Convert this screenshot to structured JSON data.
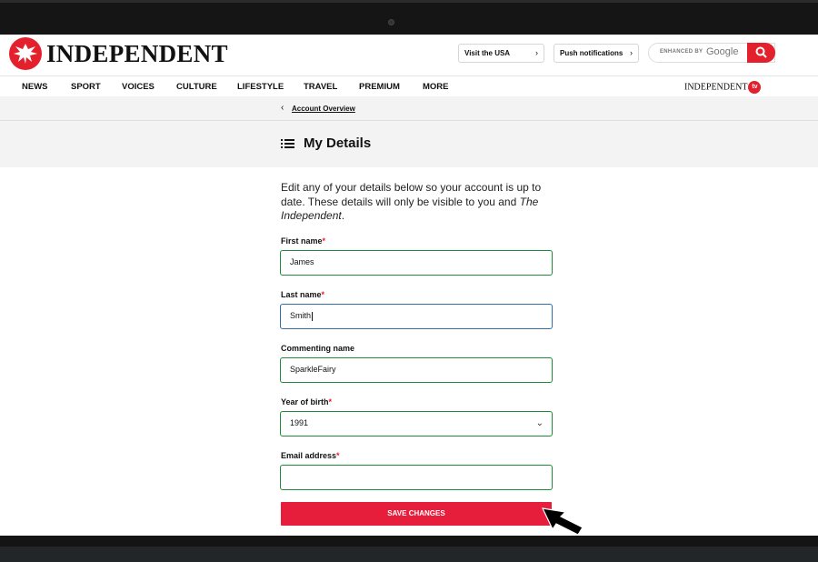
{
  "header": {
    "logo_text": "INDEPENDENT",
    "pills": [
      {
        "label": "Visit the USA"
      },
      {
        "label": "Push notifications"
      }
    ],
    "search": {
      "enhanced_label": "ENHANCED BY",
      "provider": "Google"
    }
  },
  "nav": {
    "items": [
      "NEWS",
      "SPORT",
      "VOICES",
      "CULTURE",
      "LIFESTYLE",
      "TRAVEL",
      "PREMIUM",
      "MORE"
    ],
    "tv_label": "INDEPENDENT",
    "tv_badge": "tv"
  },
  "breadcrumb": "Account Overview",
  "page_title": "My Details",
  "intro": {
    "text": "Edit any of your details below so your account is up to date. These details will only be visible to you and ",
    "publication": "The Independent",
    "end": "."
  },
  "form": {
    "required_mark": "*",
    "first_name": {
      "label": "First name",
      "value": "James"
    },
    "last_name": {
      "label": "Last name",
      "value": "Smith"
    },
    "commenting_name": {
      "label": "Commenting name",
      "value": "SparkleFairy"
    },
    "year_of_birth": {
      "label": "Year of birth",
      "value": "1991"
    },
    "email": {
      "label": "Email address",
      "value": ""
    },
    "save_label": "SAVE CHANGES"
  },
  "colors": {
    "brand_red": "#e3202b",
    "valid_green": "#1f8a3a",
    "focus_blue": "#2f6ea8"
  }
}
